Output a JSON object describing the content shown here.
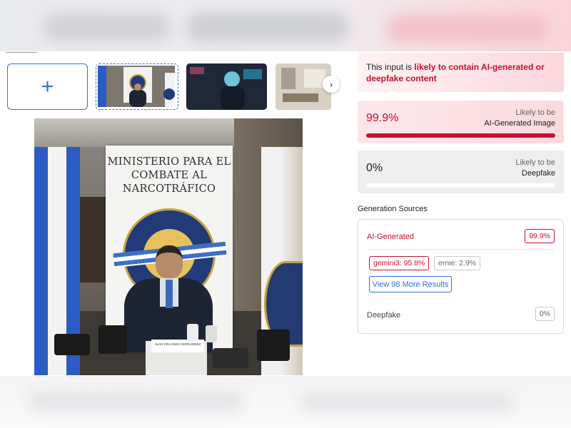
{
  "upload": {
    "add_icon": "plus-icon",
    "thumbnails": [
      {
        "name": "press-conference",
        "selected": true
      },
      {
        "name": "neon-portrait",
        "selected": false
      },
      {
        "name": "interior-room",
        "selected": false
      }
    ],
    "next_icon": "chevron-right-icon",
    "collapse_icon": "chevron-up-icon"
  },
  "photo": {
    "banner_title": "MINISTERIO PARA EL COMBATE AL NARCOTRÁFICO",
    "placard_text": "JUAN ORLANDO HERNÁNDEZ"
  },
  "result": {
    "notice_prefix": "This input is ",
    "notice_highlight": "likely to contain AI-generated or deepfake content",
    "ai_generated": {
      "percent_text": "99.9%",
      "percent_value": 99.9,
      "likely_label": "Likely to be",
      "category": "AI-Generated Image"
    },
    "deepfake": {
      "percent_text": "0%",
      "percent_value": 0,
      "likely_label": "Likely to be",
      "category": "Deepfake"
    }
  },
  "sources": {
    "title": "Generation Sources",
    "ai_label": "AI-Generated",
    "ai_score": "99.9%",
    "models": [
      {
        "label": "gemini3: 95.8%",
        "highlight": true
      },
      {
        "label": "ernie: 2.9%",
        "highlight": false
      }
    ],
    "more_button": "View 98 More Results",
    "deepfake_label": "Deepfake",
    "deepfake_score": "0%"
  },
  "colors": {
    "accent_red": "#c8102e",
    "accent_blue": "#2f6fdd"
  }
}
